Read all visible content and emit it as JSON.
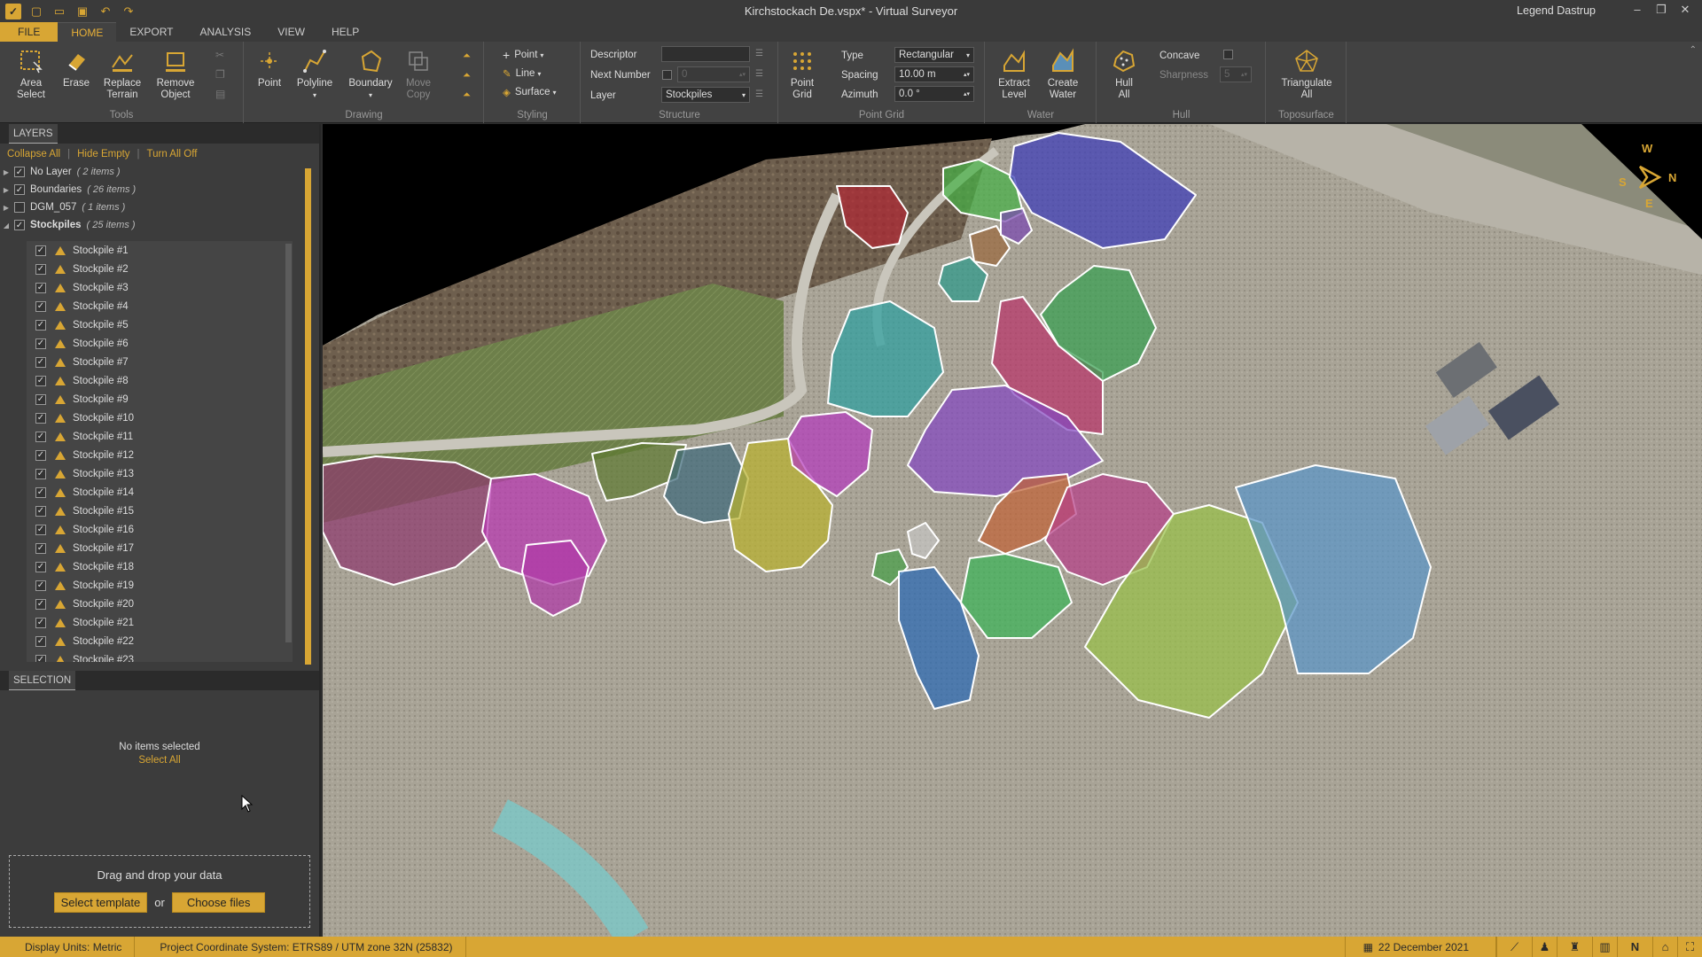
{
  "titlebar": {
    "title": "Kirchstockach De.vspx* - Virtual Surveyor",
    "user": "Legend Dastrup"
  },
  "tabs": [
    "FILE",
    "HOME",
    "EXPORT",
    "ANALYSIS",
    "VIEW",
    "HELP"
  ],
  "ribbon": {
    "tools": {
      "label": "Tools",
      "area_select": "Area Select",
      "erase": "Erase",
      "replace_terrain": "Replace Terrain",
      "remove_object": "Remove Object"
    },
    "drawing": {
      "label": "Drawing",
      "point": "Point",
      "polyline": "Polyline",
      "boundary": "Boundary",
      "move_copy": "Move Copy"
    },
    "styling": {
      "label": "Styling",
      "point": "Point",
      "line": "Line",
      "surface": "Surface"
    },
    "structure": {
      "label": "Structure",
      "descriptor": "Descriptor",
      "next_number": "Next Number",
      "next_number_value": "0",
      "layer": "Layer",
      "layer_value": "Stockpiles"
    },
    "point_grid": {
      "label": "Point Grid",
      "button": "Point Grid",
      "type": "Type",
      "type_value": "Rectangular",
      "spacing": "Spacing",
      "spacing_value": "10.00 m",
      "azimuth": "Azimuth",
      "azimuth_value": "0.0 °"
    },
    "water": {
      "label": "Water",
      "extract": "Extract Level",
      "create": "Create Water"
    },
    "hull": {
      "label": "Hull",
      "button": "Hull All",
      "concave": "Concave",
      "sharpness": "Sharpness",
      "sharpness_value": "5"
    },
    "toposurface": {
      "label": "Toposurface",
      "button": "Triangulate All"
    }
  },
  "layers": {
    "header": "LAYERS",
    "collapse": "Collapse All",
    "hide_empty": "Hide Empty",
    "turn_off": "Turn All Off",
    "groups": [
      {
        "name": "No Layer",
        "count": "( 2 items )",
        "checked": true
      },
      {
        "name": "Boundaries",
        "count": "( 26 items )",
        "checked": true
      },
      {
        "name": "DGM_057",
        "count": "( 1 items )",
        "checked": false
      },
      {
        "name": "Stockpiles",
        "count": "( 25 items )",
        "checked": true
      }
    ],
    "stockpiles": [
      "Stockpile #1",
      "Stockpile #2",
      "Stockpile #3",
      "Stockpile #4",
      "Stockpile #5",
      "Stockpile #6",
      "Stockpile #7",
      "Stockpile #8",
      "Stockpile #9",
      "Stockpile #10",
      "Stockpile #11",
      "Stockpile #12",
      "Stockpile #13",
      "Stockpile #14",
      "Stockpile #15",
      "Stockpile #16",
      "Stockpile #17",
      "Stockpile #18",
      "Stockpile #19",
      "Stockpile #20",
      "Stockpile #21",
      "Stockpile #22",
      "Stockpile #23"
    ]
  },
  "selection": {
    "header": "SELECTION",
    "empty": "No items selected",
    "select_all": "Select All"
  },
  "drop": {
    "title": "Drag and drop your data",
    "template": "Select template",
    "or": "or",
    "choose": "Choose files"
  },
  "compass": {
    "n": "N",
    "s": "S",
    "e": "E",
    "w": "W"
  },
  "status": {
    "units": "Display Units:  Metric",
    "crs": "Project Coordinate System:  ETRS89 / UTM zone 32N (25832)",
    "date": "22 December 2021",
    "north": "N"
  },
  "colors": {
    "accent": "#d8a634"
  }
}
